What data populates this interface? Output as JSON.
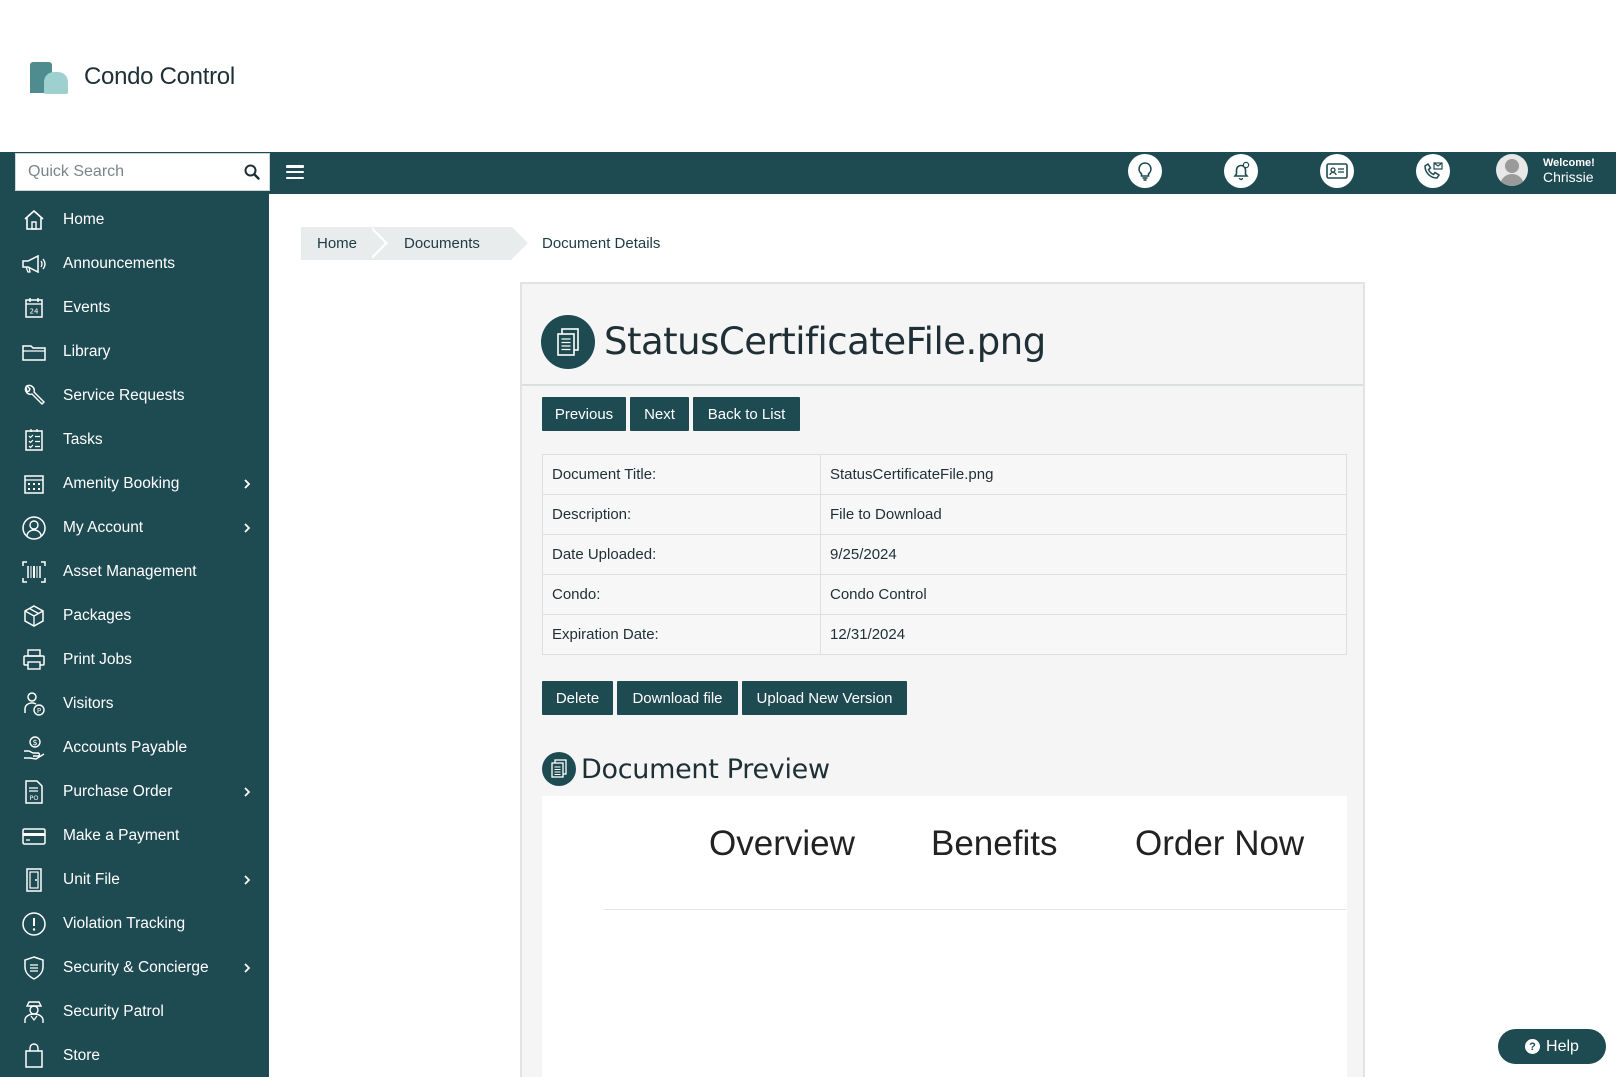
{
  "brand": {
    "name": "Condo Control",
    "accent": "#1e4a52"
  },
  "search": {
    "placeholder": "Quick Search"
  },
  "header": {
    "welcome": "Welcome!",
    "user": "Chrissie"
  },
  "sidebar": {
    "items": [
      {
        "label": "Home",
        "icon": "home-icon"
      },
      {
        "label": "Announcements",
        "icon": "megaphone-icon"
      },
      {
        "label": "Events",
        "icon": "calendar-icon"
      },
      {
        "label": "Library",
        "icon": "folder-icon"
      },
      {
        "label": "Service Requests",
        "icon": "wrench-icon"
      },
      {
        "label": "Tasks",
        "icon": "checklist-icon"
      },
      {
        "label": "Amenity Booking",
        "icon": "calendar-grid-icon"
      },
      {
        "label": "My Account",
        "icon": "user-circle-icon"
      },
      {
        "label": "Asset Management",
        "icon": "barcode-icon"
      },
      {
        "label": "Packages",
        "icon": "package-icon"
      },
      {
        "label": "Print Jobs",
        "icon": "printer-icon"
      },
      {
        "label": "Visitors",
        "icon": "visitor-icon"
      },
      {
        "label": "Accounts Payable",
        "icon": "money-hand-icon"
      },
      {
        "label": "Purchase Order",
        "icon": "po-document-icon"
      },
      {
        "label": "Make a Payment",
        "icon": "credit-card-icon"
      },
      {
        "label": "Unit File",
        "icon": "door-icon"
      },
      {
        "label": "Violation Tracking",
        "icon": "alert-circle-icon"
      },
      {
        "label": "Security & Concierge",
        "icon": "shield-icon"
      },
      {
        "label": "Security Patrol",
        "icon": "guard-icon"
      },
      {
        "label": "Store",
        "icon": "shopping-bag-icon"
      }
    ]
  },
  "breadcrumb": {
    "home": "Home",
    "documents": "Documents",
    "current": "Document Details"
  },
  "document": {
    "title": "StatusCertificateFile.png",
    "nav": {
      "previous": "Previous",
      "next": "Next",
      "back": "Back to List"
    },
    "rows": [
      {
        "key": "Document Title:",
        "value": "StatusCertificateFile.png"
      },
      {
        "key": "Description:",
        "value": "File to Download"
      },
      {
        "key": "Date Uploaded:",
        "value": "9/25/2024"
      },
      {
        "key": "Condo:",
        "value": "Condo Control"
      },
      {
        "key": "Expiration Date:",
        "value": "12/31/2024"
      }
    ],
    "actions": {
      "delete": "Delete",
      "download": "Download file",
      "upload": "Upload New Version"
    }
  },
  "preview": {
    "title": "Document Preview",
    "tabs": [
      "Overview",
      "Benefits",
      "Order Now"
    ]
  },
  "help": {
    "label": "Help"
  }
}
